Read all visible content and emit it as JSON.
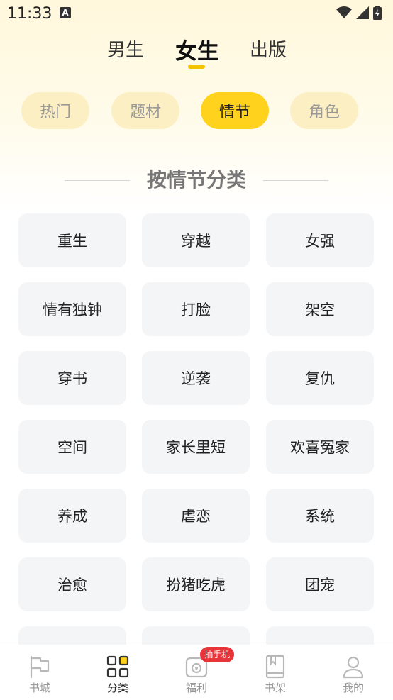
{
  "status_bar": {
    "time": "11:33",
    "notification_icon": "A"
  },
  "gender_tabs": [
    {
      "label": "男生",
      "active": false
    },
    {
      "label": "女生",
      "active": true
    },
    {
      "label": "出版",
      "active": false
    }
  ],
  "category_chips": [
    {
      "label": "热门",
      "active": false
    },
    {
      "label": "题材",
      "active": false
    },
    {
      "label": "情节",
      "active": true
    },
    {
      "label": "角色",
      "active": false
    }
  ],
  "section": {
    "title": "按情节分类"
  },
  "tags": [
    [
      "重生",
      "穿越",
      "女强"
    ],
    [
      "情有独钟",
      "打脸",
      "架空"
    ],
    [
      "穿书",
      "逆袭",
      "复仇"
    ],
    [
      "空间",
      "家长里短",
      "欢喜冤家"
    ],
    [
      "养成",
      "虐恋",
      "系统"
    ],
    [
      "治愈",
      "扮猪吃虎",
      "团宠"
    ]
  ],
  "bottom_nav": [
    {
      "label": "书城",
      "icon": "flag-icon",
      "active": false
    },
    {
      "label": "分类",
      "icon": "grid-icon",
      "active": true
    },
    {
      "label": "福利",
      "icon": "gift-icon",
      "active": false,
      "badge": "抽手机"
    },
    {
      "label": "书架",
      "icon": "bookshelf-icon",
      "active": false
    },
    {
      "label": "我的",
      "icon": "person-icon",
      "active": false
    }
  ],
  "colors": {
    "accent": "#ffd21e",
    "chip_bg": "#fdefc4",
    "badge": "#e8353a"
  }
}
